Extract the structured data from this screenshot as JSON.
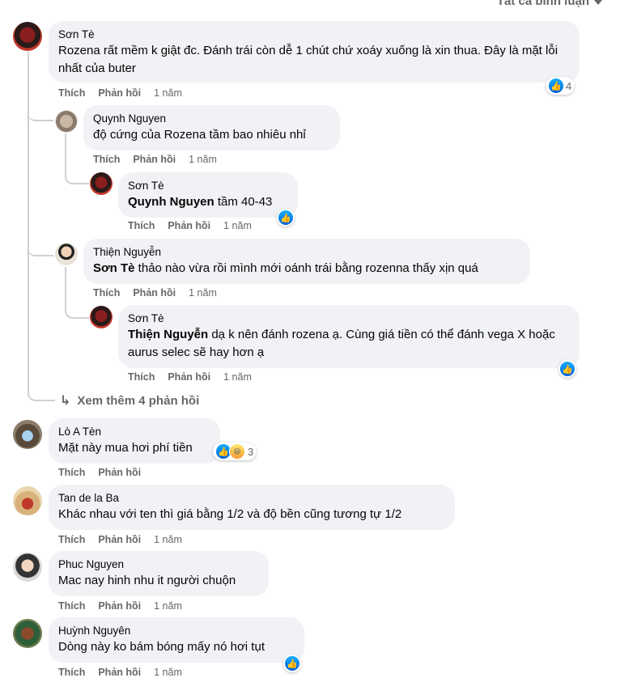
{
  "sort_label": "Tất cả bình luận",
  "action_like": "Thích",
  "action_reply": "Phản hồi",
  "comments": [
    {
      "name": "Sơn Tè",
      "text": "Rozena rất mềm k giật đc. Đánh trái còn dễ 1 chút chứ xoáy xuống là xin thua. Đây là mặt lỗi nhất của buter",
      "time": "1 năm",
      "reaction_count": "4"
    },
    {
      "name": "Quynh Nguyen",
      "text": "độ cứng của Rozena tầm bao nhiêu nhỉ",
      "time": "1 năm"
    },
    {
      "name": "Sơn Tè",
      "mention": "Quynh Nguyen",
      "text": " tầm 40-43",
      "time": "1 năm"
    },
    {
      "name": "Thiện Nguyễn",
      "mention": "Sơn Tè",
      "text": " thảo nào vừa rồi mình mới oánh trái bằng rozenna thấy xịn quá",
      "time": "1 năm"
    },
    {
      "name": "Sơn Tè",
      "mention": "Thiện Nguyễn",
      "text": " dạ k nên đánh rozena ạ. Cùng giá tiền có thể đánh vega X hoặc aurus selec sẽ hay hơn ạ",
      "time": "1 năm"
    },
    {
      "name": "Lò A Tèn",
      "text": "Mặt này mua hơi phí tiền",
      "time": "",
      "reaction_count": "3"
    },
    {
      "name": "Tan de la Ba",
      "text": "Khác nhau với ten thì giá bằng 1/2 và độ bền cũng tương tự 1/2",
      "time": "1 năm"
    },
    {
      "name": "Phuc Nguyen",
      "text": "Mac nay hinh nhu it người chuộn",
      "time": "1 năm"
    },
    {
      "name": "Huỳnh Nguyên",
      "text": "Dòng này ko bám bóng mấy nó hơi tụt",
      "time": "1 năm"
    }
  ],
  "more_replies": "Xem thêm 4 phản hồi",
  "colors": {
    "bubble": "#f0f2f5",
    "secondary_text": "#65676b",
    "like_blue": "#0866ff"
  }
}
